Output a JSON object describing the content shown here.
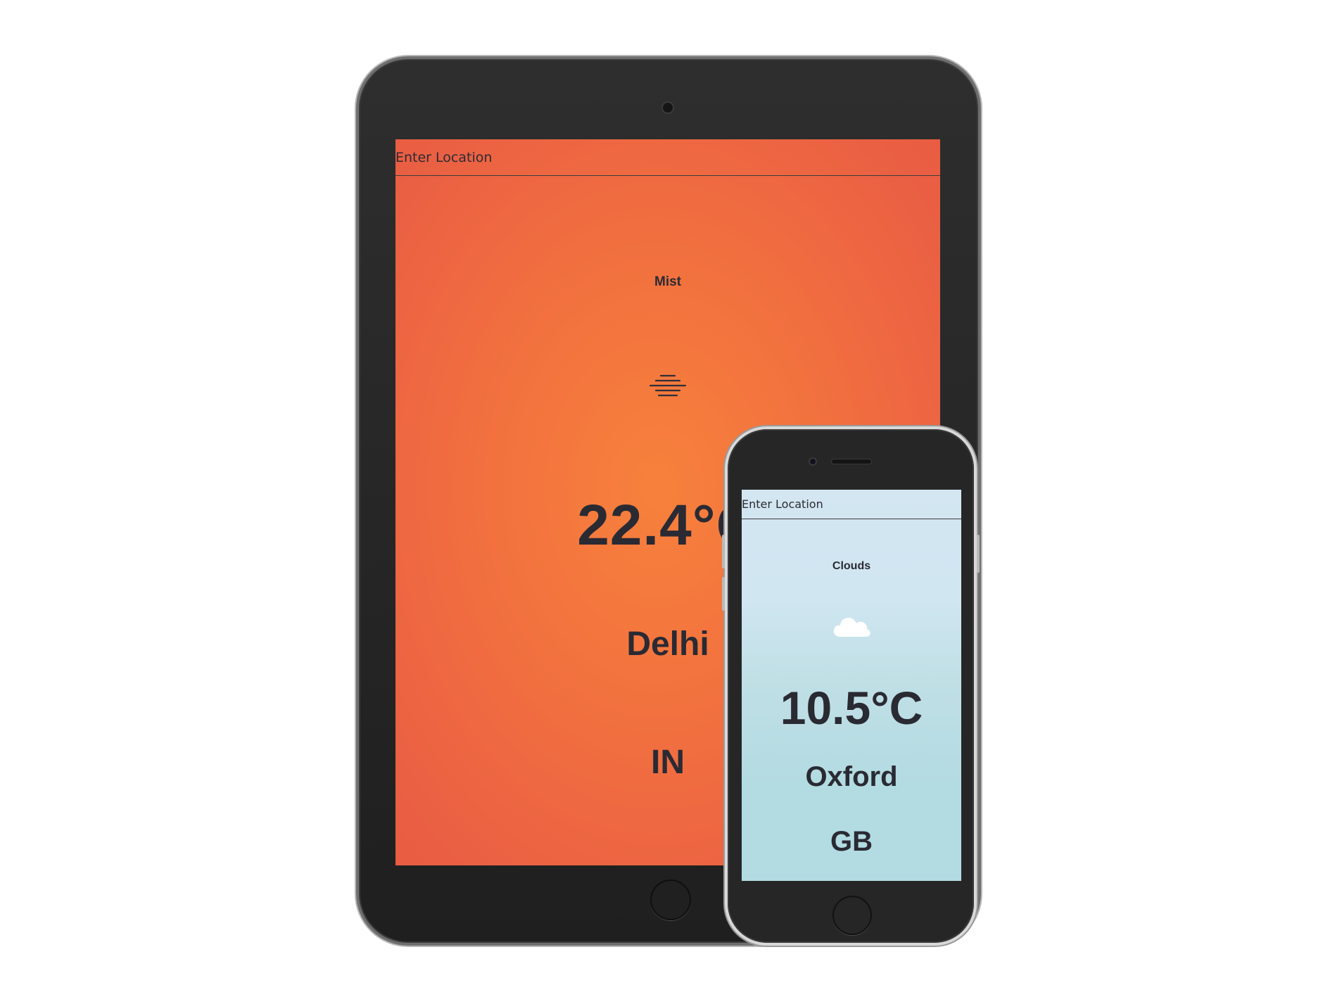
{
  "tablet": {
    "accent": "#f3743e",
    "search": {
      "placeholder": "Enter Location",
      "value": ""
    },
    "weather": {
      "condition": "Mist",
      "icon": "mist-icon",
      "temperature": "22.4°C",
      "city": "Delhi",
      "country": "IN"
    }
  },
  "phone": {
    "accent": "#c6e2ea",
    "search": {
      "placeholder": "Enter Location",
      "value": ""
    },
    "weather": {
      "condition": "Clouds",
      "icon": "cloud-icon",
      "temperature": "10.5°C",
      "city": "Oxford",
      "country": "GB"
    }
  }
}
